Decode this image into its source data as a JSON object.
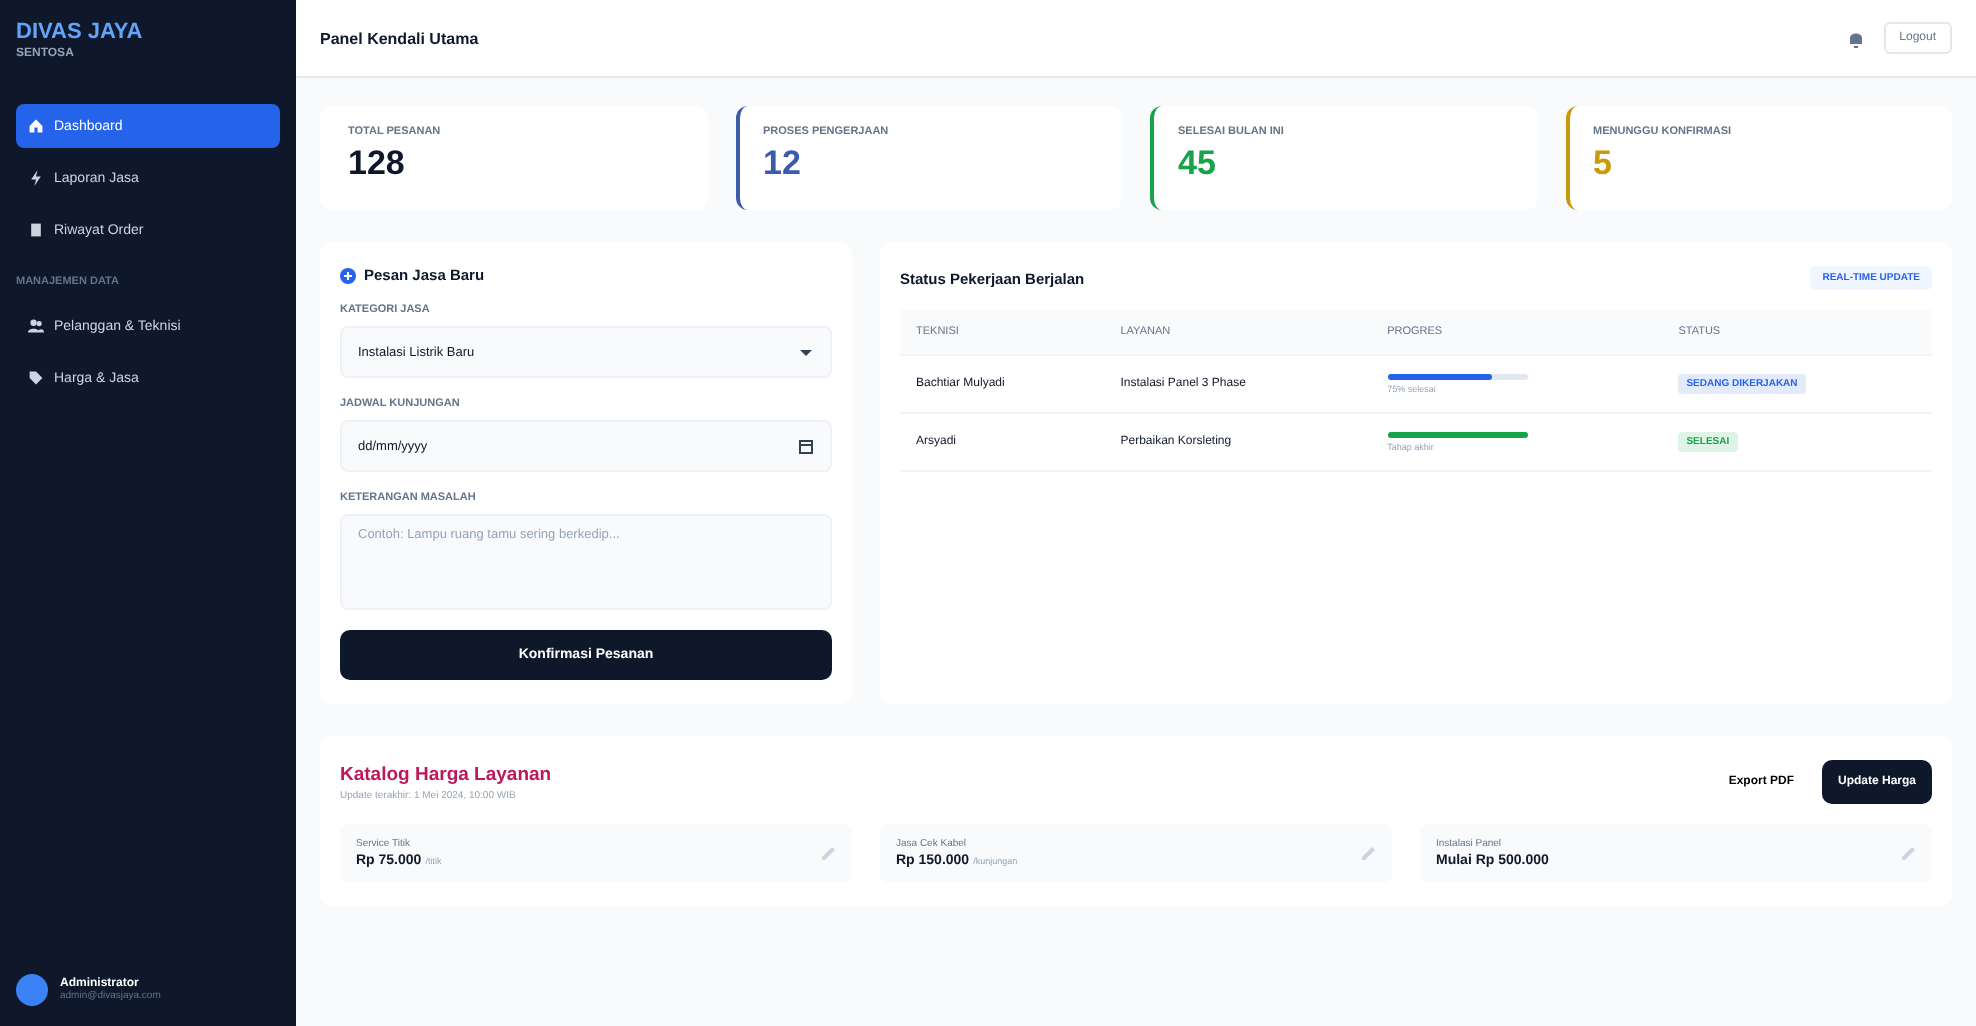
{
  "sidebar": {
    "brand": "DIVAS JAYA",
    "tagline": "SENTOSA",
    "items": [
      {
        "label": "Dashboard",
        "kind": "home",
        "selected": true
      },
      {
        "label": "Laporan Jasa",
        "kind": "bolt",
        "selected": false
      },
      {
        "label": "Riwayat Order",
        "kind": "document",
        "selected": false
      }
    ],
    "section": "MANAJEMEN DATA",
    "items2": [
      {
        "label": "Pelanggan & Teknisi",
        "kind": "users",
        "selected": false
      },
      {
        "label": "Harga & Jasa",
        "kind": "tag",
        "selected": false
      }
    ],
    "user": {
      "name": "Administrator",
      "email": "admin@divasjaya.com"
    }
  },
  "header": {
    "title": "Panel Kendali Utama",
    "logout": "Logout"
  },
  "stats": [
    {
      "label": "TOTAL PESANAN",
      "value": "128",
      "color": "#0f172a"
    },
    {
      "label": "PROSES PENGERJAAN",
      "value": "12",
      "color": "#3b5bab"
    },
    {
      "label": "SELESAI BULAN INI",
      "value": "45",
      "color": "#16a34a"
    },
    {
      "label": "MENUNGGU KONFIRMASI",
      "value": "5",
      "color": "#ca9a0a"
    }
  ],
  "form": {
    "title": "Pesan Jasa Baru",
    "fields": [
      {
        "kind": "select",
        "label": "KATEGORI JASA",
        "value": "Instalasi Listrik Baru"
      },
      {
        "kind": "date",
        "label": "JADWAL KUNJUNGAN",
        "value": "dd/mm/yyyy"
      },
      {
        "kind": "textarea",
        "label": "KETERANGAN MASALAH",
        "placeholder": "Contoh: Lampu ruang tamu sering berkedip..."
      }
    ],
    "submit": "Konfirmasi Pesanan"
  },
  "jobs": {
    "title": "Status Pekerjaan Berjalan",
    "badge": "REAL-TIME UPDATE",
    "columns": [
      "TEKNISI",
      "LAYANAN",
      "PROGRES",
      "STATUS"
    ],
    "rows": [
      {
        "technician": "Bachtiar Mulyadi",
        "service": "Instalasi Panel 3 Phase",
        "level": 0.75,
        "note": "75% selesai",
        "status": "SEDANG DIKERJAKAN",
        "color": "#2563eb"
      },
      {
        "technician": "Arsyadi",
        "service": "Perbaikan Korsleting",
        "level": 1,
        "note": "Tahap akhir",
        "status": "SELESAI",
        "color": "#16a34a"
      }
    ]
  },
  "catalog": {
    "title": "Katalog Harga Layanan",
    "subtitle": "Update terakhir: 1 Mei 2024, 10:00 WIB",
    "export": "Export PDF",
    "update": "Update Harga",
    "items": [
      {
        "name": "Service Titik",
        "price": "Rp 75.000",
        "unit": "/titik"
      },
      {
        "name": "Jasa Cek Kabel",
        "price": "Rp 150.000",
        "unit": "/kunjungan"
      },
      {
        "name": "Instalasi Panel",
        "price": "Mulai Rp 500.000"
      }
    ]
  }
}
